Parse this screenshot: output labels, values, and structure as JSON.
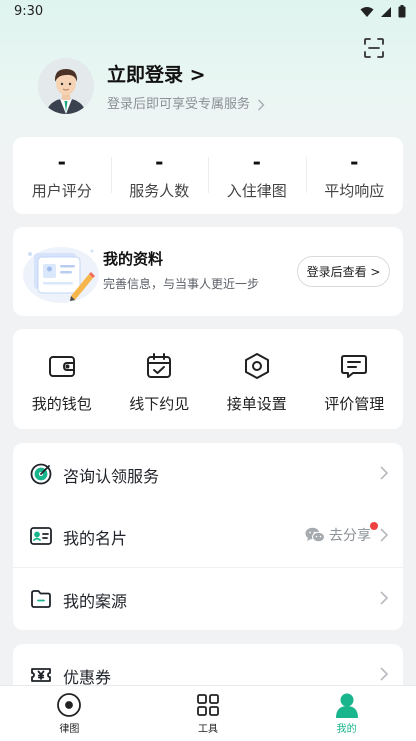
{
  "status_bar": {
    "time": "9:30"
  },
  "header": {
    "login_title": "立即登录 >",
    "login_subtitle": "登录后即可享受专属服务"
  },
  "stats": [
    {
      "value": "-",
      "label": "用户评分"
    },
    {
      "value": "-",
      "label": "服务人数"
    },
    {
      "value": "-",
      "label": "入住律图"
    },
    {
      "value": "-",
      "label": "平均响应"
    }
  ],
  "profile_card": {
    "title": "我的资料",
    "subtitle": "完善信息，与当事人更近一步",
    "button_label": "登录后查看 >"
  },
  "tools": [
    {
      "label": "我的钱包",
      "icon": "wallet-icon"
    },
    {
      "label": "线下约见",
      "icon": "calendar-check-icon"
    },
    {
      "label": "接单设置",
      "icon": "settings-hexagon-icon"
    },
    {
      "label": "评价管理",
      "icon": "comment-icon"
    }
  ],
  "menu": {
    "consult_service": "咨询认领服务",
    "business_card": "我的名片",
    "share_label": "去分享",
    "case_source": "我的案源",
    "coupon": "优惠券"
  },
  "bottom_nav": [
    {
      "label": "律图",
      "icon": "home-circle-icon"
    },
    {
      "label": "工具",
      "icon": "grid-icon"
    },
    {
      "label": "我的",
      "icon": "person-icon",
      "active": true
    }
  ],
  "colors": {
    "accent": "#19b58c",
    "badge_red": "#f04141"
  }
}
